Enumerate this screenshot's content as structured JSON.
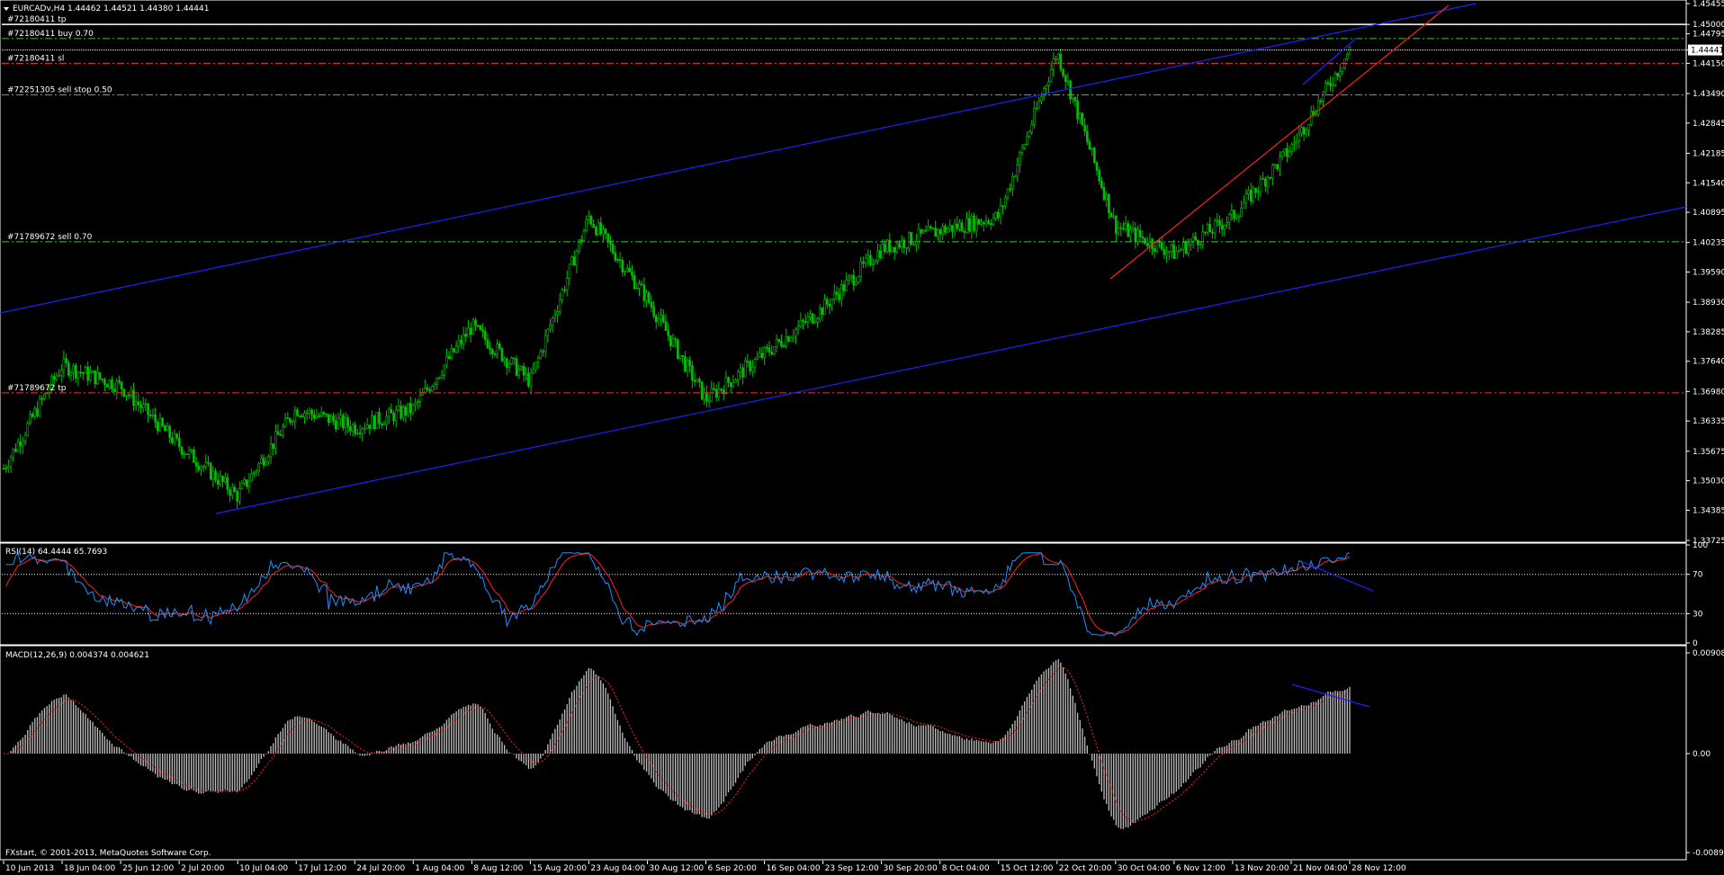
{
  "window": {
    "symbol_header": "EURCADv,H4  1.44462 1.44521 1.44380 1.44441",
    "footer": "FXstart, © 2001-2013, MetaQuotes Software Corp."
  },
  "price_panel": {
    "y_ticks": [
      "1.45455",
      "1.45000",
      "1.44795",
      "1.44441",
      "1.44150",
      "1.43490",
      "1.42845",
      "1.42185",
      "1.41540",
      "1.40895",
      "1.40235",
      "1.39590",
      "1.38930",
      "1.38285",
      "1.37640",
      "1.36980",
      "1.36335",
      "1.35675",
      "1.35030",
      "1.34385",
      "1.33725"
    ],
    "current_price": "1.44441",
    "order_lines": [
      {
        "label": "#72180411 tp",
        "price": 1.45,
        "color": "#ff3030",
        "style": "dashdot"
      },
      {
        "label": "#72180411 buy 0.70",
        "price": 1.4469,
        "color": "#40c040",
        "style": "dashdot"
      },
      {
        "label": "#72180411 sl",
        "price": 1.4415,
        "color": "#ff3030",
        "style": "dashdot"
      },
      {
        "label": "#72251305 sell stop 0.50",
        "price": 1.4346,
        "color": "#40c040",
        "style": "dashdot"
      },
      {
        "label": "#71789672 sell 0.70",
        "price": 1.4025,
        "color": "#40c040",
        "style": "dashdot"
      },
      {
        "label": "#71789672 tp",
        "price": 1.3695,
        "color": "#ff3030",
        "style": "dashdot"
      }
    ],
    "candle_color": "#00c000",
    "channel_color": "#2020ff",
    "trend_color": "#ff2020"
  },
  "rsi_panel": {
    "header": "RSI(14) 64.4444 65.7693",
    "y_ticks": [
      "100",
      "70",
      "30",
      "0"
    ],
    "line_color": "#1e90ff",
    "signal_color": "#ff2020"
  },
  "macd_panel": {
    "header": "MACD(12,26,9) 0.004374 0.004621",
    "y_ticks": [
      "0.00908",
      "0.00",
      "-0.0089"
    ],
    "bar_color": "#c0c0c0",
    "signal_color": "#ff2020"
  },
  "time_axis": {
    "labels": [
      "10 Jun 2013",
      "18 Jun 04:00",
      "25 Jun 12:00",
      "2 Jul 20:00",
      "10 Jul 04:00",
      "17 Jul 12:00",
      "24 Jul 20:00",
      "1 Aug 04:00",
      "8 Aug 12:00",
      "15 Aug 20:00",
      "23 Aug 04:00",
      "30 Aug 12:00",
      "6 Sep 20:00",
      "16 Sep 04:00",
      "23 Sep 12:00",
      "30 Sep 20:00",
      "8 Oct 04:00",
      "15 Oct 12:00",
      "22 Oct 20:00",
      "30 Oct 04:00",
      "6 Nov 12:00",
      "13 Nov 20:00",
      "21 Nov 04:00",
      "28 Nov 12:00"
    ]
  },
  "chart_data": {
    "type": "line",
    "title": "EURCADv,H4",
    "series": [
      {
        "name": "EURCADv",
        "x": [
          "10 Jun 2013",
          "18 Jun 04:00",
          "25 Jun 12:00",
          "2 Jul 20:00",
          "10 Jul 04:00",
          "17 Jul 12:00",
          "24 Jul 20:00",
          "1 Aug 04:00",
          "8 Aug 12:00",
          "15 Aug 20:00",
          "23 Aug 04:00",
          "30 Aug 12:00",
          "6 Sep 20:00",
          "16 Sep 04:00",
          "23 Sep 12:00",
          "30 Sep 20:00",
          "8 Oct 04:00",
          "15 Oct 12:00",
          "22 Oct 20:00",
          "30 Oct 04:00",
          "6 Nov 12:00",
          "13 Nov 20:00",
          "21 Nov 04:00",
          "28 Nov 12:00"
        ],
        "values": [
          1.353,
          1.3755,
          1.371,
          1.358,
          1.347,
          1.366,
          1.362,
          1.366,
          1.384,
          1.372,
          1.408,
          1.39,
          1.368,
          1.378,
          1.388,
          1.401,
          1.405,
          1.408,
          1.444,
          1.406,
          1.4,
          1.408,
          1.423,
          1.4444
        ]
      }
    ],
    "ylim": [
      1.33725,
      1.45455
    ],
    "grid": false
  }
}
